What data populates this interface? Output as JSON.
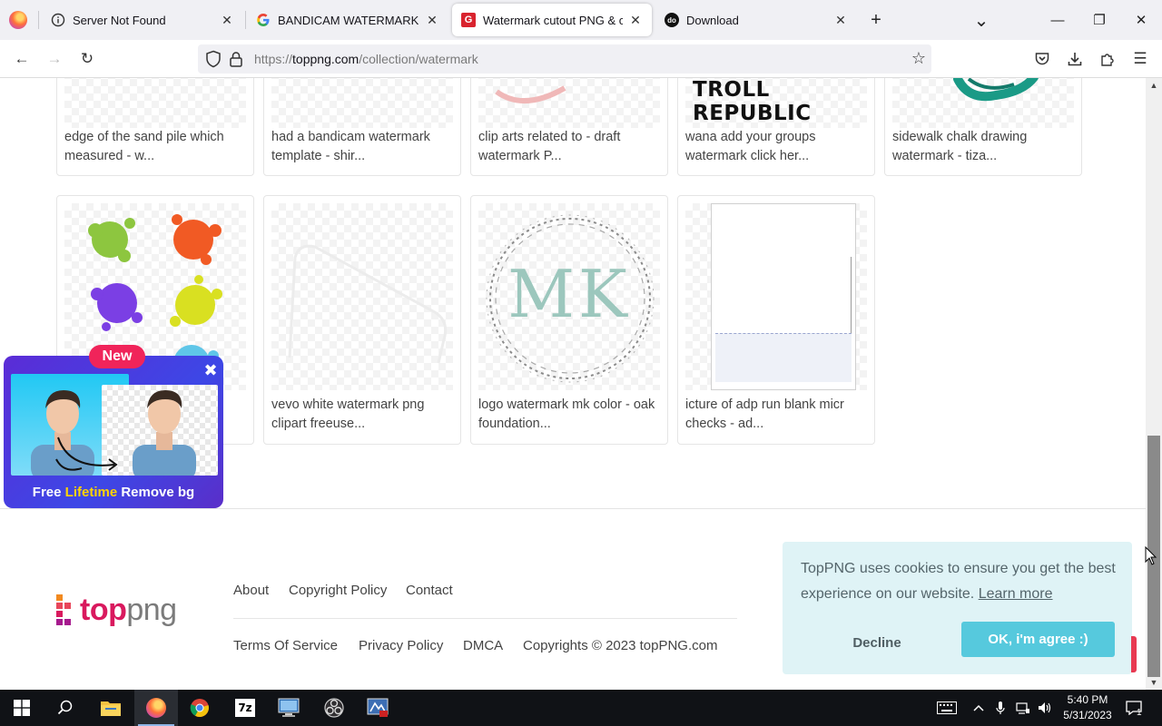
{
  "browser": {
    "tabs": [
      {
        "title": "Server Not Found",
        "icon": "info-icon",
        "active": false
      },
      {
        "title": "BANDICAM WATERMARK - Goo",
        "icon": "google-icon",
        "active": false
      },
      {
        "title": "Watermark cutout PNG & clipa",
        "icon": "toppng-favicon",
        "active": true
      },
      {
        "title": "Download",
        "icon": "dot-favicon",
        "active": false
      }
    ],
    "tab_close_glyph": "✕",
    "new_tab_glyph": "+",
    "url_prefix": "https://",
    "url_host": "toppng.com",
    "url_path": "/collection/watermark",
    "icons": {
      "back": "←",
      "forward": "→",
      "reload": "↻",
      "star": "☆",
      "pocket": "pocket-icon",
      "downloads": "download-icon",
      "extensions": "puzzle-icon",
      "menu": "☰"
    },
    "window": {
      "minimize": "—",
      "restore": "❐",
      "close": "✕",
      "list_tabs": "⌄"
    }
  },
  "cards_row1": [
    {
      "caption": "edge of the sand pile which measured - w..."
    },
    {
      "caption": "had a bandicam watermark template - shir..."
    },
    {
      "caption": "clip arts related to - draft watermark P..."
    },
    {
      "caption": "wana add your groups watermark click her...",
      "thumb_text": "TROLL REPUBLIC"
    },
    {
      "caption": "sidewalk chalk drawing watermark - tiza..."
    }
  ],
  "cards_row2": [
    {
      "caption": ""
    },
    {
      "caption": "vevo white watermark png clipart freeuse..."
    },
    {
      "caption": "logo watermark mk color - oak foundation...",
      "thumb_text": "MK"
    },
    {
      "caption": "icture of adp run blank micr checks - ad..."
    }
  ],
  "promo": {
    "badge": "New",
    "close": "✖",
    "text_before": "Free ",
    "text_highlight": "Lifetime",
    "text_after": " Remove bg"
  },
  "footer": {
    "logo_top": "top",
    "logo_png": "png",
    "links_row1": [
      "About",
      "Copyright Policy",
      "Contact"
    ],
    "links_row2": [
      "Terms Of Service",
      "Privacy Policy",
      "DMCA"
    ],
    "copyright": "Copyrights © 2023 topPNG.com"
  },
  "cookie": {
    "message": "TopPNG uses cookies to ensure you get the best experience on our website.",
    "learn_more": "Learn more",
    "decline": "Decline",
    "agree": "OK, i'm agree :)"
  },
  "scrollbar": {
    "up": "▲",
    "down": "▼"
  },
  "taskbar": {
    "time": "5:40 PM",
    "date": "5/31/2023",
    "notification_count": "1",
    "apps": [
      "start-icon",
      "search-icon",
      "file-explorer-icon",
      "firefox-icon",
      "chrome-icon",
      "7zip-icon",
      "remote-desktop-icon",
      "obs-icon",
      "network-tool-icon"
    ]
  },
  "colors": {
    "accent_pink": "#d9195e",
    "cookie_bg": "#dff3f6",
    "cookie_btn": "#56c9dd",
    "promo_purple": "#5b2cd6",
    "promo_badge": "#f0245a",
    "taskbar": "#101216"
  }
}
